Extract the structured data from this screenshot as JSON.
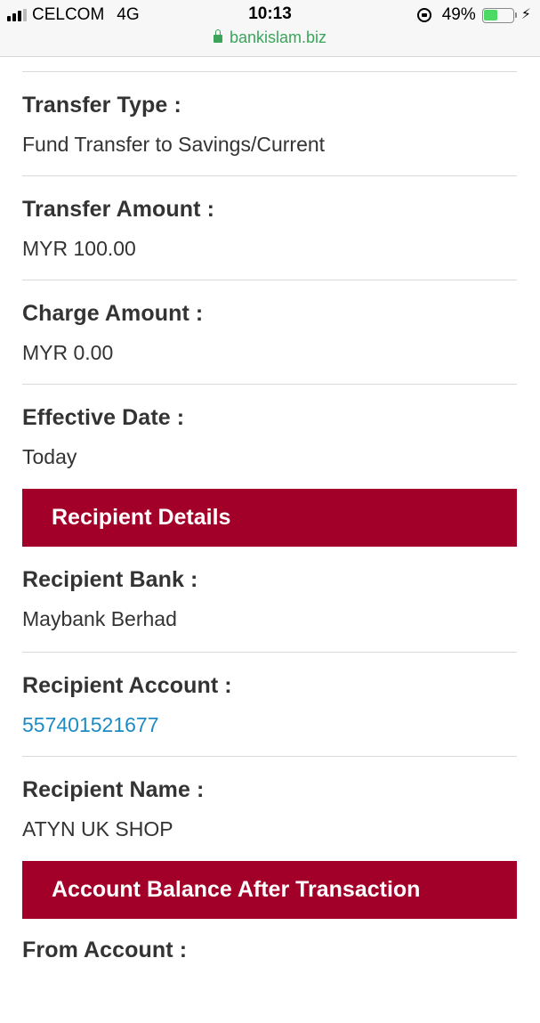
{
  "status_bar": {
    "carrier": "CELCOM",
    "network": "4G",
    "time": "10:13",
    "url": "bankislam.biz",
    "battery_percent": "49%",
    "battery_level": 0.49,
    "signal_bars_active": 3,
    "signal_bars_total": 4
  },
  "transfer_details": [
    {
      "label": "Transfer Type :",
      "value": "Fund Transfer to Savings/Current"
    },
    {
      "label": "Transfer Amount :",
      "value": "MYR 100.00"
    },
    {
      "label": "Charge Amount :",
      "value": "MYR 0.00"
    },
    {
      "label": "Effective Date :",
      "value": "Today"
    }
  ],
  "recipient_section": {
    "title": "Recipient Details",
    "fields": [
      {
        "label": "Recipient Bank :",
        "value": "Maybank Berhad"
      },
      {
        "label": "Recipient Account :",
        "value": "557401521677"
      },
      {
        "label": "Recipient Name :",
        "value": "ATYN UK SHOP"
      }
    ]
  },
  "balance_section": {
    "title": "Account Balance After Transaction",
    "fields": [
      {
        "label": "From Account :"
      }
    ]
  },
  "colors": {
    "section_header_bg": "#a30029",
    "link": "#1e8bc3",
    "url_green": "#3aa55a",
    "battery_green": "#4cd964"
  }
}
